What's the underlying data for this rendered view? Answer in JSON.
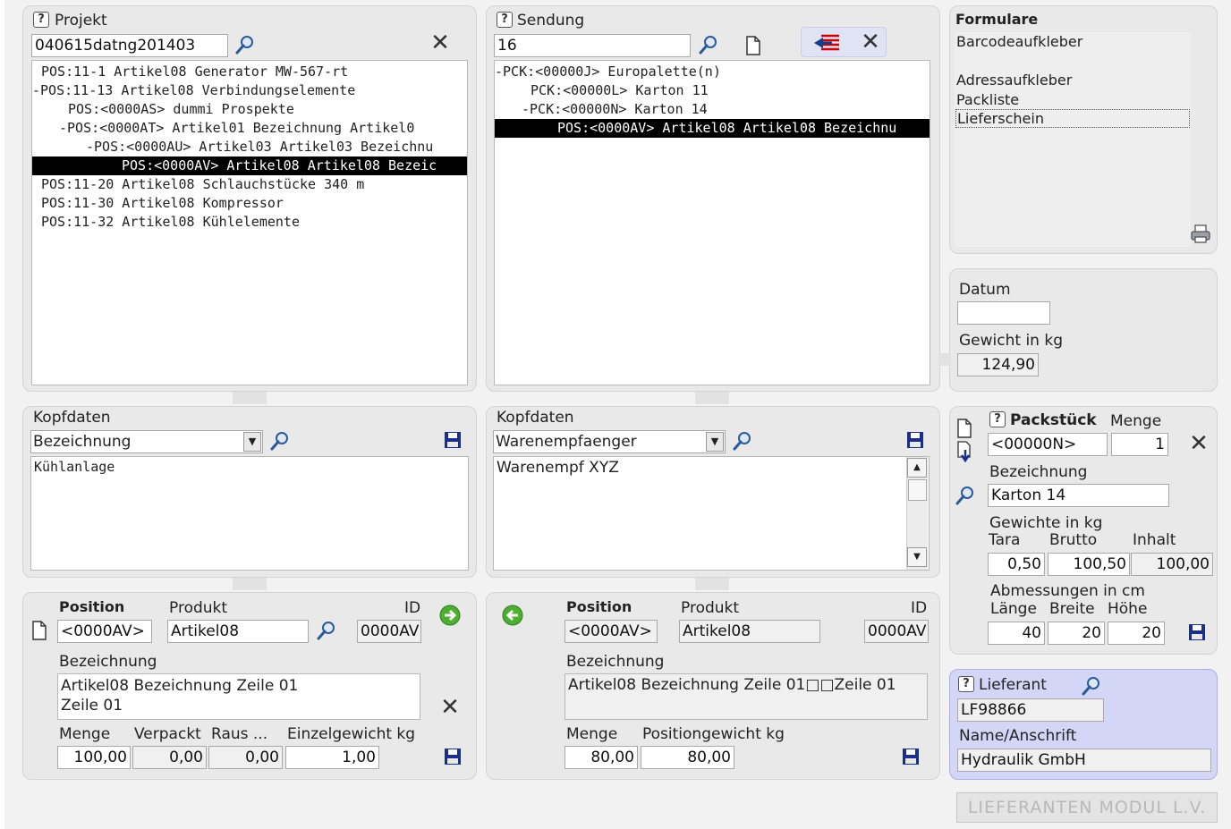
{
  "projekt": {
    "title": "Projekt",
    "input_value": "040615datng201403",
    "tree": [
      "POS:11-1 Artikel08 Generator MW-567-rt",
      "-POS:11-13 Artikel08 Verbindungselemente",
      "POS:<0000AS> dummi Prospekte",
      "-POS:<0000AT> Artikel01 Bezeichnung Artikel0",
      "-POS:<0000AU> Artikel03 Artikel03 Bezeichnu",
      "POS:<0000AV> Artikel08 Artikel08 Bezeic",
      "POS:11-20 Artikel08 Schlauchstücke 340 m",
      "POS:11-30 Artikel08 Kompressor",
      "POS:11-32 Artikel08 Kühlelemente"
    ]
  },
  "sendung": {
    "title": "Sendung",
    "input_value": "16",
    "tree": [
      "-PCK:<00000J> Europalette(n)",
      "PCK:<00000L> Karton 11",
      "-PCK:<00000N> Karton 14",
      "POS:<0000AV> Artikel08 Artikel08 Bezeichnu"
    ]
  },
  "formulare": {
    "title": "Formulare",
    "items": [
      "Barcodeaufkleber",
      "Adressaufkleber",
      "Packliste",
      "Lieferschein"
    ]
  },
  "datum_gewicht": {
    "datum_label": "Datum",
    "datum_value": "",
    "gewicht_label": "Gewicht in kg",
    "gewicht_value": "124,90"
  },
  "kopfdaten_left": {
    "title": "Kopfdaten",
    "select_value": "Bezeichnung",
    "text": "Kühlanlage"
  },
  "kopfdaten_mid": {
    "title": "Kopfdaten",
    "select_value": "Warenempfaenger",
    "text": "Warenempf XYZ"
  },
  "packstueck": {
    "title": "Packstück",
    "menge_label": "Menge",
    "id_value": "<00000N>",
    "menge_value": "1",
    "bezeichnung_label": "Bezeichnung",
    "bezeichnung_value": "Karton 14",
    "gewichte_label": "Gewichte in kg",
    "tara_label": "Tara",
    "brutto_label": "Brutto",
    "inhalt_label": "Inhalt",
    "tara_value": "0,50",
    "brutto_value": "100,50",
    "inhalt_value": "100,00",
    "abmessungen_label": "Abmessungen in cm",
    "laenge_label": "Länge",
    "breite_label": "Breite",
    "hoehe_label": "Höhe",
    "laenge_value": "40",
    "breite_value": "20",
    "hoehe_value": "20"
  },
  "position_left": {
    "position_label": "Position",
    "produkt_label": "Produkt",
    "id_label": "ID",
    "position_value": "<0000AV>",
    "produkt_value": "Artikel08",
    "id_value": "0000AV",
    "bezeichnung_label": "Bezeichnung",
    "bezeichnung_line1": "Artikel08 Bezeichnung Zeile 01",
    "bezeichnung_line2": "Zeile 01",
    "menge_label": "Menge",
    "verpackt_label": "Verpackt",
    "raus_label": "Raus ...",
    "einzelgewicht_label": "Einzelgewicht kg",
    "menge_value": "100,00",
    "verpackt_value": "0,00",
    "raus_value": "0,00",
    "einzelgewicht_value": "1,00"
  },
  "position_mid": {
    "position_label": "Position",
    "produkt_label": "Produkt",
    "id_label": "ID",
    "position_value": "<0000AV>",
    "produkt_value": "Artikel08",
    "id_value": "0000AV",
    "bezeichnung_label": "Bezeichnung",
    "bezeichnung_value": "Artikel08 Bezeichnung Zeile 01□□Zeile 01",
    "menge_label": "Menge",
    "positionsgewicht_label": "Positiongewicht kg",
    "menge_value": "80,00",
    "positionsgewicht_value": "80,00"
  },
  "lieferant": {
    "title": "Lieferant",
    "id_value": "LF98866",
    "name_label": "Name/Anschrift",
    "name_value": "Hydraulik GmbH"
  },
  "modul_button_label": "LIEFERANTEN MODUL   L.V."
}
